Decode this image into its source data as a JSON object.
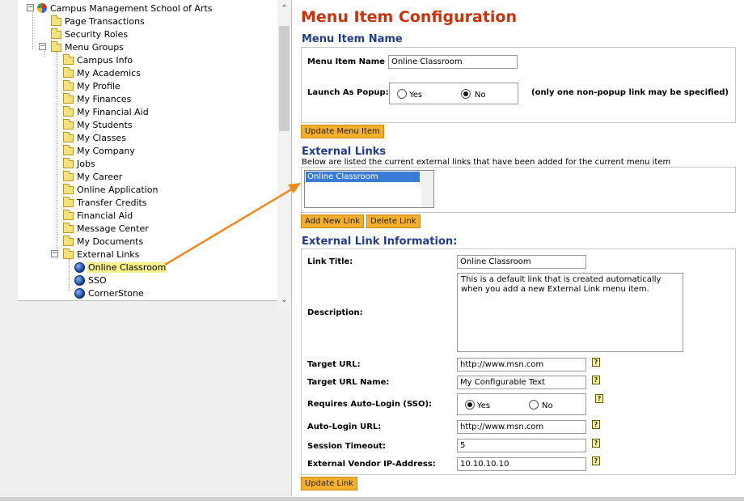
{
  "tree": {
    "root": "Campus Management School of Arts",
    "items": [
      {
        "label": "Page Transactions"
      },
      {
        "label": "Security Roles"
      },
      {
        "label": "Menu Groups"
      },
      {
        "label": "Campus Info"
      },
      {
        "label": "My Academics"
      },
      {
        "label": "My Profile"
      },
      {
        "label": "My Finances"
      },
      {
        "label": "My Financial Aid"
      },
      {
        "label": "My Students"
      },
      {
        "label": "My Classes"
      },
      {
        "label": "My Company"
      },
      {
        "label": "Jobs"
      },
      {
        "label": "My Career"
      },
      {
        "label": "Online Application"
      },
      {
        "label": "Transfer Credits"
      },
      {
        "label": "Financial Aid"
      },
      {
        "label": "Message Center"
      },
      {
        "label": "My Documents"
      },
      {
        "label": "External Links"
      },
      {
        "label": "Online Classroom"
      },
      {
        "label": "SSO"
      },
      {
        "label": "CornerStone"
      }
    ]
  },
  "main": {
    "title": "Menu Item Configuration",
    "menu_item_name": {
      "section_title": "Menu Item Name",
      "name_label": "Menu Item Name",
      "name_value": "Online Classroom",
      "popup_label": "Launch As Popup:",
      "yes_label": "Yes",
      "no_label": "No",
      "popup_selected": "No",
      "popup_note": "(only one non-popup link may be specified)",
      "update_button": "Update Menu Item"
    },
    "external_links": {
      "section_title": "External Links",
      "description": "Below are listed the current external links that have been added for the current menu item",
      "list_items": [
        "Online Classroom"
      ],
      "add_button": "Add New Link",
      "delete_button": "Delete Link"
    },
    "link_info": {
      "section_title": "External Link Information:",
      "link_title_label": "Link Title:",
      "link_title_value": "Online Classroom",
      "description_label": "Description:",
      "description_value": "This is a default link that is created automatically when you add a new External Link menu item.",
      "target_url_label": "Target URL:",
      "target_url_value": "http://www.msn.com",
      "target_url_name_label": "Target URL Name:",
      "target_url_name_value": "My Configurable Text",
      "requires_sso_label": "Requires Auto-Login (SSO):",
      "sso_yes": "Yes",
      "sso_no": "No",
      "sso_selected": "Yes",
      "auto_login_url_label": "Auto-Login URL:",
      "auto_login_url_value": "http://www.msn.com",
      "session_timeout_label": "Session Timeout:",
      "session_timeout_value": "5",
      "vendor_ip_label": "External Vendor IP-Address:",
      "vendor_ip_value": "10.10.10.10",
      "update_button": "Update Link",
      "help_icon_text": "?"
    }
  },
  "colors": {
    "title_red": "#c8320c",
    "section_blue": "#223c8a",
    "button_orange": "#f4b02a",
    "arrow_orange": "#f08a1c",
    "selected_highlight": "#f6f18a"
  }
}
